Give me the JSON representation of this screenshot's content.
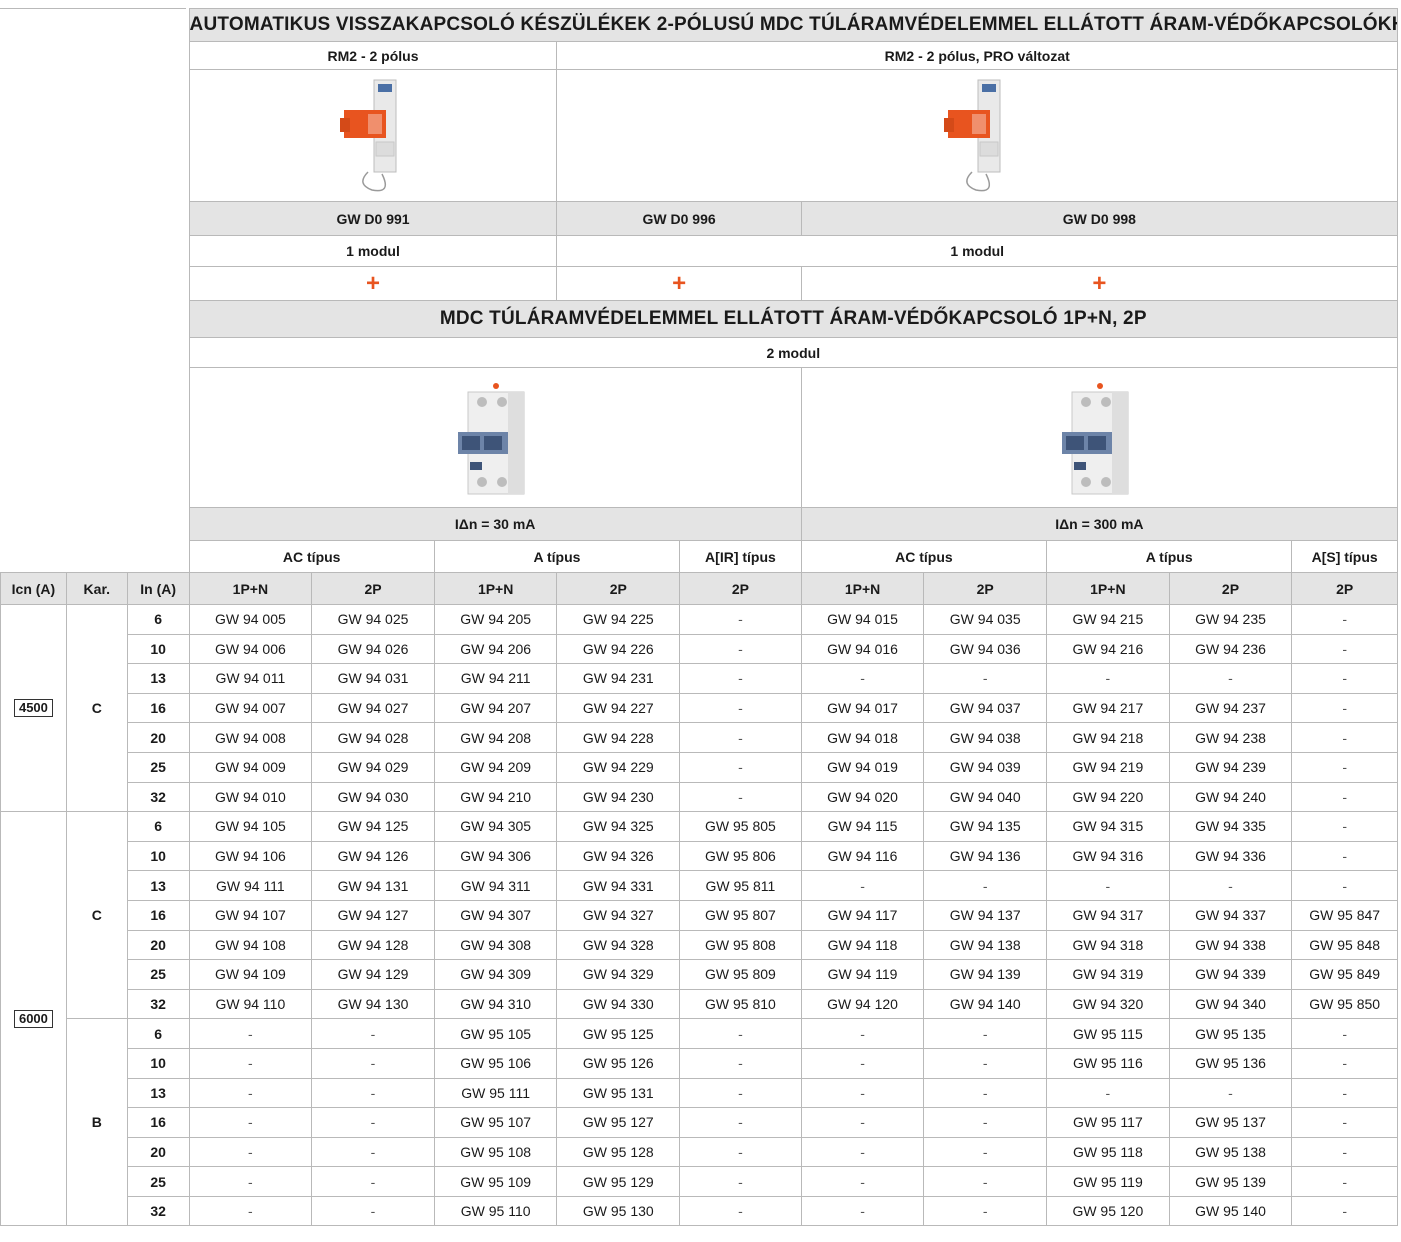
{
  "header": {
    "title": "AUTOMATIKUS VISSZAKAPCSOLÓ KÉSZÜLÉKEK 2-PÓLUSÚ MDC TÚLÁRAMVÉDELEMMEL ELLÁTOTT ÁRAM-VÉDŐKAPCSOLÓKHOZ",
    "rm2_label": "RM2 - 2 pólus",
    "rm2_pro_label": "RM2 - 2 pólus, PRO változat",
    "codes": [
      "GW D0 991",
      "GW D0 996",
      "GW D0 998"
    ],
    "modul_left": "1 modul",
    "modul_right": "1 modul",
    "plus": "+",
    "section2_title": "MDC TÚLÁRAMVÉDELEMMEL ELLÁTOTT ÁRAM-VÉDŐKAPCSOLÓ 1P+N, 2P",
    "modul2": "2 modul",
    "idn_30": "IΔn = 30 mA",
    "idn_300": "IΔn = 300 mA",
    "type_headers": [
      "AC típus",
      "A típus",
      "A[IR] típus",
      "AC típus",
      "A típus",
      "A[S] típus"
    ],
    "col_headers": [
      "Icn (A)",
      "Kar.",
      "In (A)",
      "1P+N",
      "2P",
      "1P+N",
      "2P",
      "2P",
      "1P+N",
      "2P",
      "1P+N",
      "2P",
      "2P"
    ]
  },
  "groups": [
    {
      "icn": "4500",
      "sub": [
        {
          "kar": "C",
          "rows": [
            [
              "6",
              "GW 94 005",
              "GW 94 025",
              "GW 94 205",
              "GW 94 225",
              "-",
              "GW 94 015",
              "GW 94 035",
              "GW 94 215",
              "GW 94 235",
              "-"
            ],
            [
              "10",
              "GW 94 006",
              "GW 94 026",
              "GW 94 206",
              "GW 94 226",
              "-",
              "GW 94 016",
              "GW 94 036",
              "GW 94 216",
              "GW 94 236",
              "-"
            ],
            [
              "13",
              "GW 94 011",
              "GW 94 031",
              "GW 94 211",
              "GW 94 231",
              "-",
              "-",
              "-",
              "-",
              "-",
              "-"
            ],
            [
              "16",
              "GW 94 007",
              "GW 94 027",
              "GW 94 207",
              "GW 94 227",
              "-",
              "GW 94 017",
              "GW 94 037",
              "GW 94 217",
              "GW 94 237",
              "-"
            ],
            [
              "20",
              "GW 94 008",
              "GW 94 028",
              "GW 94 208",
              "GW 94 228",
              "-",
              "GW 94 018",
              "GW 94 038",
              "GW 94 218",
              "GW 94 238",
              "-"
            ],
            [
              "25",
              "GW 94 009",
              "GW 94 029",
              "GW 94 209",
              "GW 94 229",
              "-",
              "GW 94 019",
              "GW 94 039",
              "GW 94 219",
              "GW 94 239",
              "-"
            ],
            [
              "32",
              "GW 94 010",
              "GW 94 030",
              "GW 94 210",
              "GW 94 230",
              "-",
              "GW 94 020",
              "GW 94 040",
              "GW 94 220",
              "GW 94 240",
              "-"
            ]
          ]
        }
      ]
    },
    {
      "icn": "6000",
      "sub": [
        {
          "kar": "C",
          "rows": [
            [
              "6",
              "GW 94 105",
              "GW 94 125",
              "GW 94 305",
              "GW 94 325",
              "GW 95 805",
              "GW 94 115",
              "GW 94 135",
              "GW 94 315",
              "GW 94 335",
              "-"
            ],
            [
              "10",
              "GW 94 106",
              "GW 94 126",
              "GW 94 306",
              "GW 94 326",
              "GW 95 806",
              "GW 94 116",
              "GW 94 136",
              "GW 94 316",
              "GW 94 336",
              "-"
            ],
            [
              "13",
              "GW 94 111",
              "GW 94 131",
              "GW 94 311",
              "GW 94 331",
              "GW 95 811",
              "-",
              "-",
              "-",
              "-",
              "-"
            ],
            [
              "16",
              "GW 94 107",
              "GW 94 127",
              "GW 94 307",
              "GW 94 327",
              "GW 95 807",
              "GW 94 117",
              "GW 94 137",
              "GW 94 317",
              "GW 94 337",
              "GW 95 847"
            ],
            [
              "20",
              "GW 94 108",
              "GW 94 128",
              "GW 94 308",
              "GW 94 328",
              "GW 95 808",
              "GW 94 118",
              "GW 94 138",
              "GW 94 318",
              "GW 94 338",
              "GW 95 848"
            ],
            [
              "25",
              "GW 94 109",
              "GW 94 129",
              "GW 94 309",
              "GW 94 329",
              "GW 95 809",
              "GW 94 119",
              "GW 94 139",
              "GW 94 319",
              "GW 94 339",
              "GW 95 849"
            ],
            [
              "32",
              "GW 94 110",
              "GW 94 130",
              "GW 94 310",
              "GW 94 330",
              "GW 95 810",
              "GW 94 120",
              "GW 94 140",
              "GW 94 320",
              "GW 94 340",
              "GW 95 850"
            ]
          ]
        },
        {
          "kar": "B",
          "rows": [
            [
              "6",
              "-",
              "-",
              "GW 95 105",
              "GW 95 125",
              "-",
              "-",
              "-",
              "GW 95 115",
              "GW 95 135",
              "-"
            ],
            [
              "10",
              "-",
              "-",
              "GW 95 106",
              "GW 95 126",
              "-",
              "-",
              "-",
              "GW 95 116",
              "GW 95 136",
              "-"
            ],
            [
              "13",
              "-",
              "-",
              "GW 95 111",
              "GW 95 131",
              "-",
              "-",
              "-",
              "-",
              "-",
              "-"
            ],
            [
              "16",
              "-",
              "-",
              "GW 95 107",
              "GW 95 127",
              "-",
              "-",
              "-",
              "GW 95 117",
              "GW 95 137",
              "-"
            ],
            [
              "20",
              "-",
              "-",
              "GW 95 108",
              "GW 95 128",
              "-",
              "-",
              "-",
              "GW 95 118",
              "GW 95 138",
              "-"
            ],
            [
              "25",
              "-",
              "-",
              "GW 95 109",
              "GW 95 129",
              "-",
              "-",
              "-",
              "GW 95 119",
              "GW 95 139",
              "-"
            ],
            [
              "32",
              "-",
              "-",
              "GW 95 110",
              "GW 95 130",
              "-",
              "-",
              "-",
              "GW 95 120",
              "GW 95 140",
              "-"
            ]
          ]
        }
      ]
    }
  ],
  "colors": {
    "accent_plus": "#e8541f",
    "header_gray": "#e4e4e4",
    "rule": "#b9b9b9"
  },
  "icons": [
    "rm2-relay-orange-icon",
    "mdc-breaker-icon"
  ]
}
